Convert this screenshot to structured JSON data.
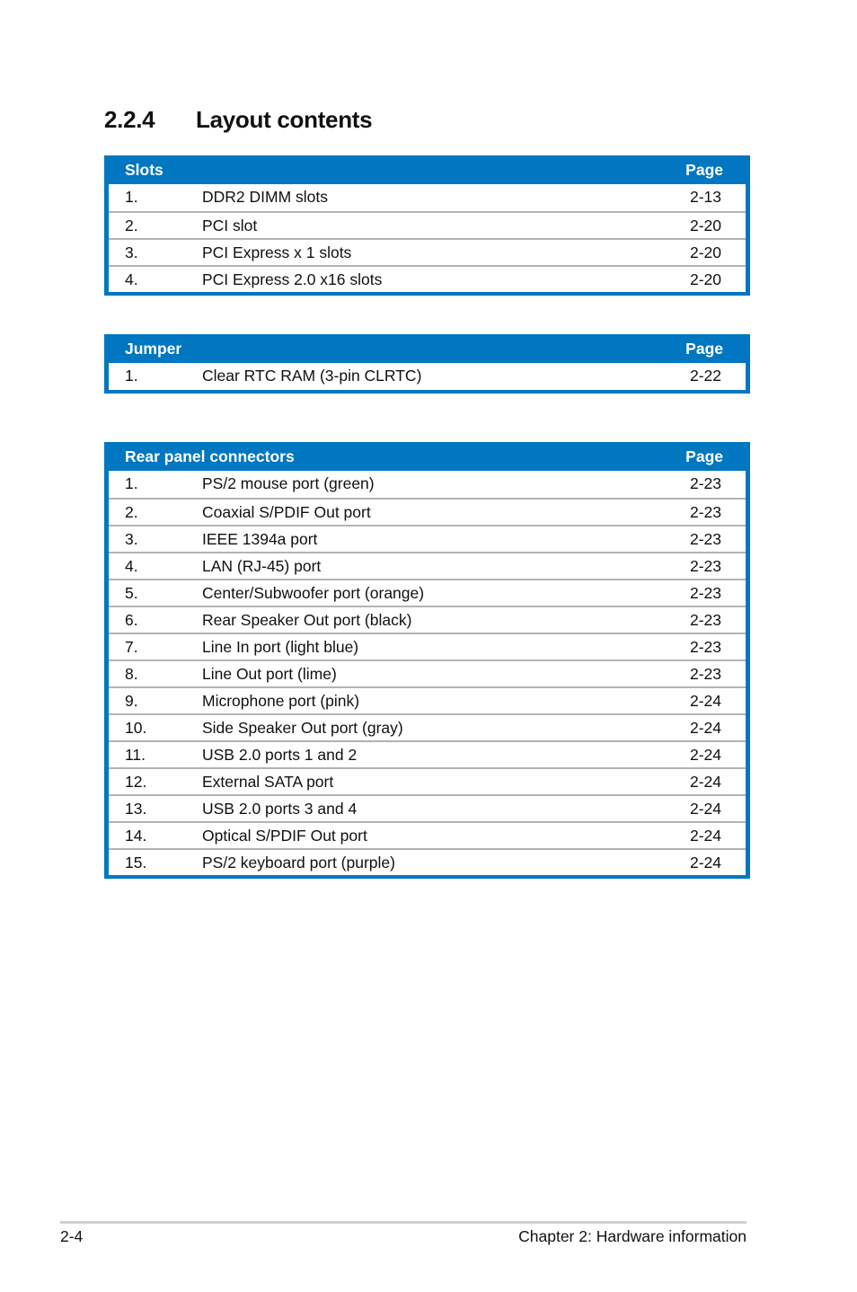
{
  "heading": {
    "number": "2.2.4",
    "title": "Layout contents"
  },
  "colors": {
    "accent": "#0077c0",
    "row_divider": "#b3b3b3"
  },
  "tables": {
    "slots": {
      "title": "Slots",
      "page_header": "Page",
      "rows": [
        {
          "num": "1.",
          "item": "DDR2 DIMM slots",
          "page": "2-13"
        },
        {
          "num": "2.",
          "item": "PCI slot",
          "page": "2-20"
        },
        {
          "num": "3.",
          "item": "PCI Express x 1 slots",
          "page": "2-20"
        },
        {
          "num": "4.",
          "item": "PCI Express 2.0 x16 slots",
          "page": "2-20"
        }
      ]
    },
    "jumper": {
      "title": "Jumper",
      "page_header": "Page",
      "rows": [
        {
          "num": "1.",
          "item": "Clear RTC RAM (3-pin CLRTC)",
          "page": "2-22"
        }
      ]
    },
    "rear": {
      "title": "Rear panel connectors",
      "page_header": "Page",
      "rows": [
        {
          "num": "1.",
          "item": "PS/2 mouse port (green)",
          "page": "2-23"
        },
        {
          "num": "2.",
          "item": "Coaxial S/PDIF Out port",
          "page": "2-23"
        },
        {
          "num": "3.",
          "item": "IEEE 1394a port",
          "page": "2-23"
        },
        {
          "num": "4.",
          "item": "LAN (RJ-45) port",
          "page": "2-23"
        },
        {
          "num": "5.",
          "item": "Center/Subwoofer port (orange)",
          "page": "2-23"
        },
        {
          "num": "6.",
          "item": "Rear Speaker Out port (black)",
          "page": "2-23"
        },
        {
          "num": "7.",
          "item": "Line In port (light blue)",
          "page": "2-23"
        },
        {
          "num": "8.",
          "item": "Line Out port (lime)",
          "page": "2-23"
        },
        {
          "num": "9.",
          "item": "Microphone port (pink)",
          "page": "2-24"
        },
        {
          "num": "10.",
          "item": "Side Speaker Out port (gray)",
          "page": "2-24"
        },
        {
          "num": "11.",
          "item": "USB 2.0 ports 1 and 2",
          "page": "2-24"
        },
        {
          "num": "12.",
          "item": "External SATA port",
          "page": "2-24"
        },
        {
          "num": "13.",
          "item": "USB 2.0 ports 3 and 4",
          "page": "2-24"
        },
        {
          "num": "14.",
          "item": "Optical S/PDIF Out port",
          "page": "2-24"
        },
        {
          "num": "15.",
          "item": "PS/2 keyboard port (purple)",
          "page": "2-24"
        }
      ]
    }
  },
  "footer": {
    "page_number": "2-4",
    "chapter": "Chapter 2: Hardware information"
  }
}
